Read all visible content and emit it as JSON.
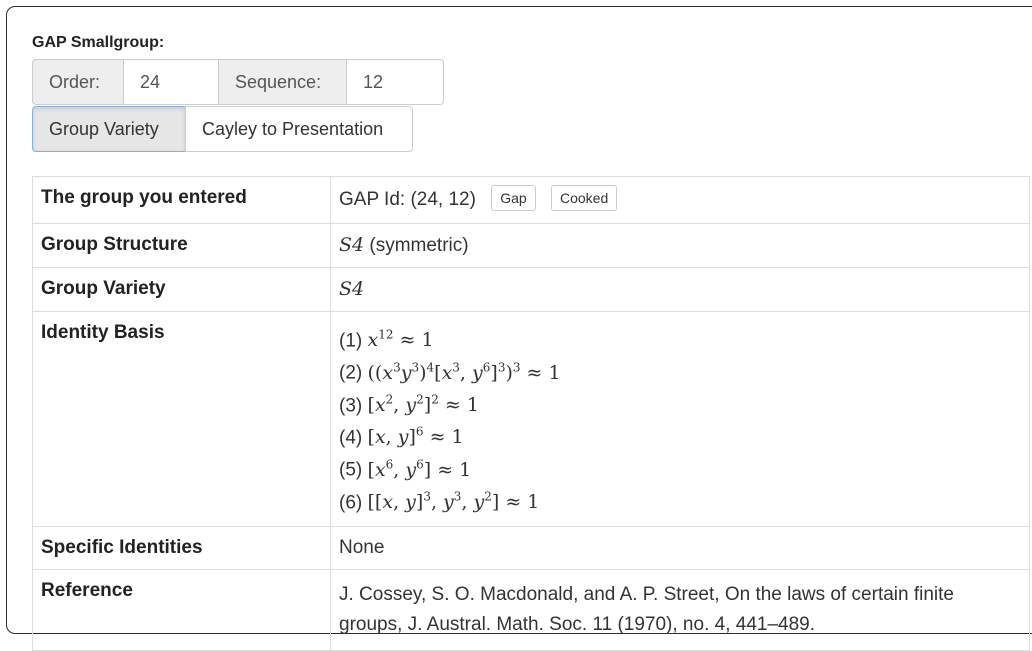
{
  "title": "GAP Smallgroup:",
  "inputs": {
    "order_label": "Order:",
    "order_value": "24",
    "sequence_label": "Sequence:",
    "sequence_value": "12"
  },
  "buttons": {
    "group_variety": "Group Variety",
    "cayley": "Cayley to Presentation"
  },
  "table": {
    "rows": [
      {
        "label": "The group you entered",
        "value": "GAP Id: (24, 12)",
        "buttons": [
          "Gap",
          "Cooked"
        ]
      },
      {
        "label": "Group Structure",
        "value_math": "S4",
        "value_rest": " (symmetric)"
      },
      {
        "label": "Group Variety",
        "value_math": "S4"
      },
      {
        "label": "Identity Basis"
      },
      {
        "label": "Specific Identities",
        "value": "None"
      },
      {
        "label": "Reference",
        "value": "J. Cossey, S. O. Macdonald, and A. P. Street, On the laws of certain finite groups, J. Austral. Math. Soc. 11 (1970), no. 4, 441–489."
      }
    ],
    "identities": [
      {
        "num": "(1)"
      },
      {
        "num": "(2)"
      },
      {
        "num": "(3)"
      },
      {
        "num": "(4)"
      },
      {
        "num": "(5)"
      },
      {
        "num": "(6)"
      }
    ]
  }
}
